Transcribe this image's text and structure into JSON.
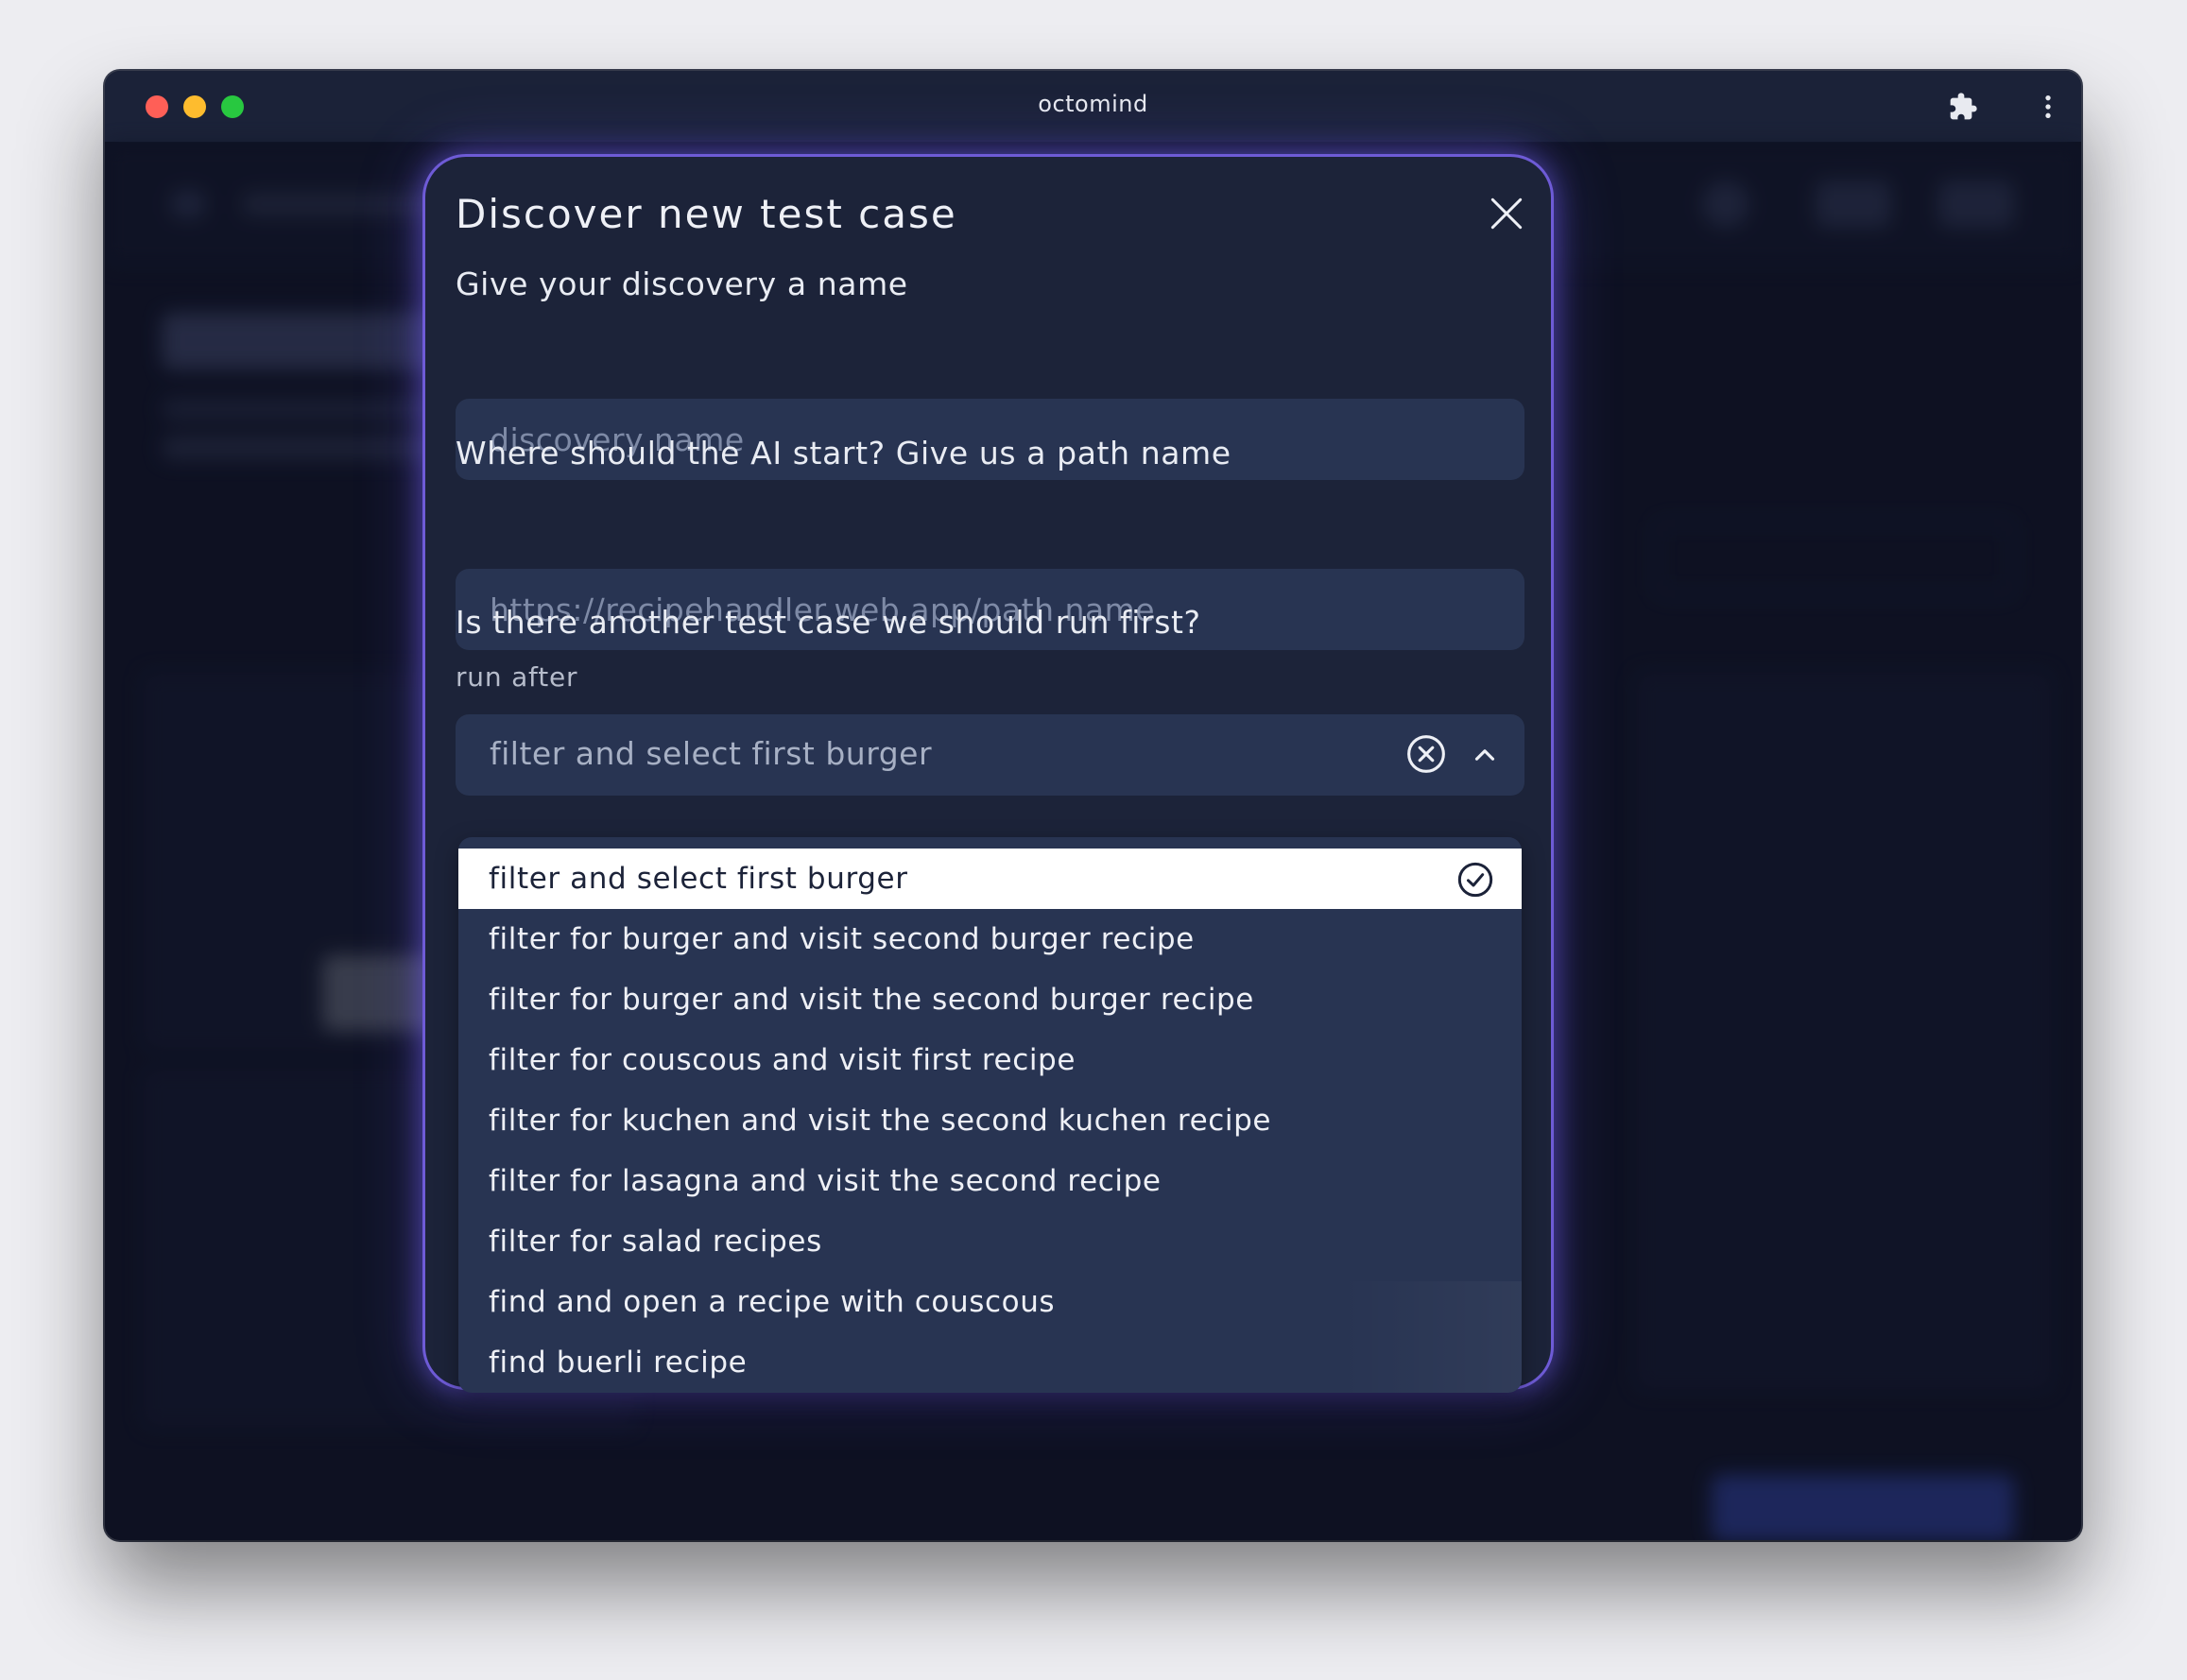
{
  "window": {
    "title": "octomind"
  },
  "modal": {
    "title": "Discover new test case",
    "name_label": "Give your discovery a name",
    "name_placeholder": "discovery name",
    "name_value": "",
    "path_label": "Where should the AI start? Give us a path name",
    "path_placeholder": "https://recipehandler.web.app/path name",
    "path_value": "",
    "dependency_label": "Is there another test case we should run first?",
    "run_after_label": "run after",
    "run_after_value": "filter and select first burger",
    "options": [
      {
        "label": "filter and select first burger",
        "selected": true
      },
      {
        "label": "filter for burger and visit second burger recipe",
        "selected": false
      },
      {
        "label": "filter for burger and visit the second burger recipe",
        "selected": false
      },
      {
        "label": "filter for couscous and visit first recipe",
        "selected": false
      },
      {
        "label": "filter for kuchen and visit the second kuchen recipe",
        "selected": false
      },
      {
        "label": "filter for lasagna and visit the second recipe",
        "selected": false
      },
      {
        "label": "filter for salad recipes",
        "selected": false
      },
      {
        "label": "find and open a recipe with couscous",
        "selected": false
      },
      {
        "label": "find buerli recipe",
        "selected": false
      }
    ]
  },
  "icons": {
    "titlebar": [
      "puzzle-icon",
      "more-vertical-icon"
    ],
    "modal": [
      "close-icon",
      "clear-circle-icon",
      "chevron-up-icon",
      "check-circle-icon"
    ]
  },
  "colors": {
    "accent_border": "#6e5bd6",
    "modal_bg": "#1c2339",
    "field_bg": "#283452",
    "selected_option_bg": "#ffffff"
  }
}
